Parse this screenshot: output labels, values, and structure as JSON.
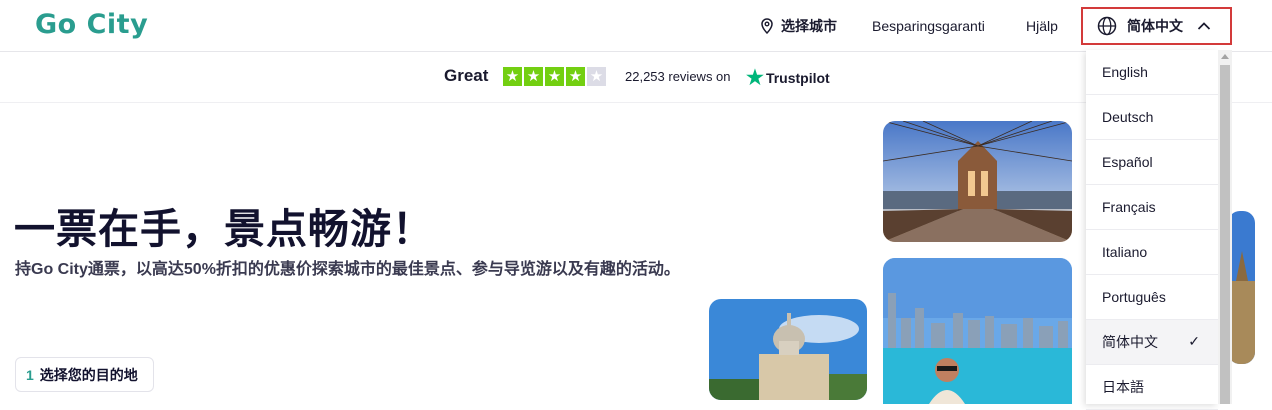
{
  "header": {
    "logo": "Go City",
    "nav": {
      "choose_city": "选择城市",
      "savings_guarantee": "Besparingsgaranti",
      "help": "Hjälp"
    },
    "language_button": "简体中文",
    "icons": {
      "location": "map-pin-icon",
      "language": "globe-icon",
      "toggle": "chevron-up-icon"
    }
  },
  "trustpilot": {
    "rating_word": "Great",
    "stars": 4.5,
    "reviews": "22,253 reviews on",
    "brand": "Trustpilot"
  },
  "hero": {
    "title": "一票在手，景点畅游！",
    "subtitle": "持Go City通票，以高达50%折扣的优惠价探索城市的最佳景点、参与导览游以及有趣的活动。",
    "step_number": "1",
    "step_label": "选择您的目的地"
  },
  "language_menu": {
    "items": [
      {
        "label": "English",
        "selected": false
      },
      {
        "label": "Deutsch",
        "selected": false
      },
      {
        "label": "Español",
        "selected": false
      },
      {
        "label": "Français",
        "selected": false
      },
      {
        "label": "Italiano",
        "selected": false
      },
      {
        "label": "Português",
        "selected": false
      },
      {
        "label": "简体中文",
        "selected": true
      },
      {
        "label": "日本語",
        "selected": false
      }
    ],
    "check_mark": "✓"
  },
  "colors": {
    "brand_teal": "#2a9d8f",
    "trustpilot_green": "#73cf11",
    "focus_outline": "#d33a3a"
  }
}
